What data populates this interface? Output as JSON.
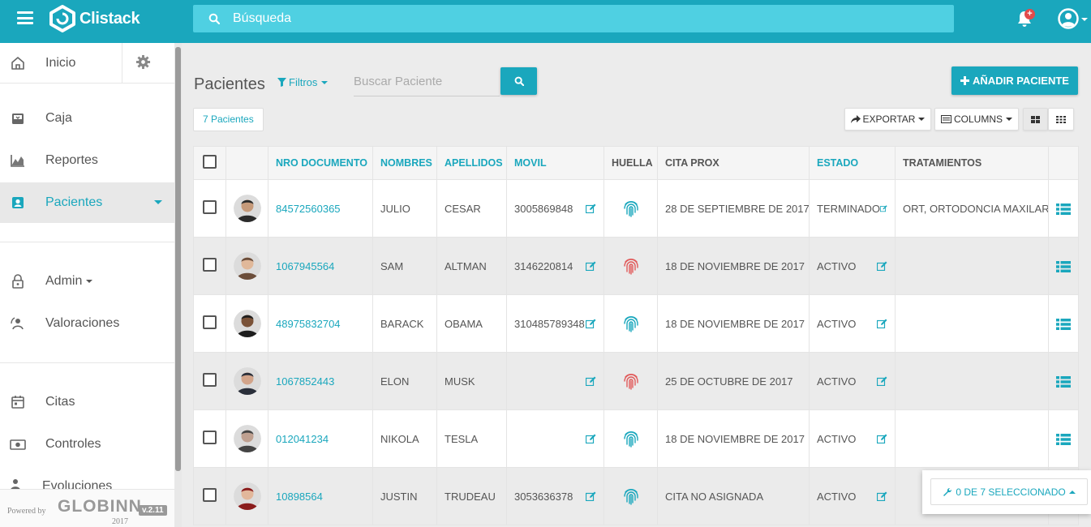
{
  "app": {
    "name": "Clistack"
  },
  "topbar": {
    "search_placeholder": "Búsqueda",
    "notifications_badge": "+"
  },
  "sidebar": {
    "home": "Inicio",
    "items": [
      {
        "label": "Caja",
        "icon": "cash-register-icon"
      },
      {
        "label": "Reportes",
        "icon": "chart-icon"
      },
      {
        "label": "Pacientes",
        "icon": "patient-card-icon",
        "active": true
      },
      {
        "label": "Admin",
        "icon": "lock-icon"
      },
      {
        "label": "Valoraciones",
        "icon": "rating-icon"
      },
      {
        "label": "Citas",
        "icon": "calendar-icon"
      },
      {
        "label": "Controles",
        "icon": "money-icon"
      },
      {
        "label": "Evoluciones",
        "icon": "users-icon"
      }
    ],
    "footer": {
      "powered": "Powered by",
      "brand": "GLOBINN",
      "version": "v.2.11",
      "year": "2017"
    }
  },
  "main": {
    "title": "Pacientes",
    "filters_label": "Filtros",
    "search_placeholder": "Buscar Paciente",
    "add_button": "AÑADIR PACIENTE",
    "count_label": "7 Pacientes",
    "export_label": "EXPORTAR",
    "columns_label": "COLUMNS"
  },
  "table": {
    "headers": {
      "doc": "NRO DOCUMENTO",
      "names": "NOMBRES",
      "surnames": "APELLIDOS",
      "mobile": "MOVIL",
      "fingerprint": "HUELLA",
      "next_appointment": "CITA PROX",
      "status": "ESTADO",
      "treatments": "TRATAMIENTOS"
    },
    "rows": [
      {
        "doc": "84572560365",
        "names": "JULIO",
        "surnames": "CESAR",
        "mobile": "3005869848",
        "fingerprint": "registered",
        "next": "28 DE SEPTIEMBRE DE 2017",
        "status": "TERMINADO",
        "treatments": "ORT, ORTODONCIA MAXILAR"
      },
      {
        "doc": "1067945564",
        "names": "SAM",
        "surnames": "ALTMAN",
        "mobile": "3146220814",
        "fingerprint": "missing",
        "next": "18 DE NOVIEMBRE DE 2017",
        "status": "ACTIVO",
        "treatments": ""
      },
      {
        "doc": "48975832704",
        "names": "BARACK",
        "surnames": "OBAMA",
        "mobile": "310485789348",
        "fingerprint": "registered",
        "next": "18 DE NOVIEMBRE DE 2017",
        "status": "ACTIVO",
        "treatments": ""
      },
      {
        "doc": "1067852443",
        "names": "ELON",
        "surnames": "MUSK",
        "mobile": "",
        "fingerprint": "missing",
        "next": "25 DE OCTUBRE DE 2017",
        "status": "ACTIVO",
        "treatments": ""
      },
      {
        "doc": "012041234",
        "names": "NIKOLA",
        "surnames": "TESLA",
        "mobile": "",
        "fingerprint": "registered",
        "next": "18 DE NOVIEMBRE DE 2017",
        "status": "ACTIVO",
        "treatments": ""
      },
      {
        "doc": "10898564",
        "names": "JUSTIN",
        "surnames": "TRUDEAU",
        "mobile": "3053636378",
        "fingerprint": "registered",
        "next": "CITA NO ASIGNADA",
        "status": "ACTIVO",
        "treatments": ""
      }
    ]
  },
  "selection": {
    "label": "0 DE 7 SELECCIONADO"
  },
  "colors": {
    "accent": "#1aa7bd",
    "fingerprint_ok": "#1aa7bd",
    "fingerprint_missing": "#e15a5a"
  }
}
